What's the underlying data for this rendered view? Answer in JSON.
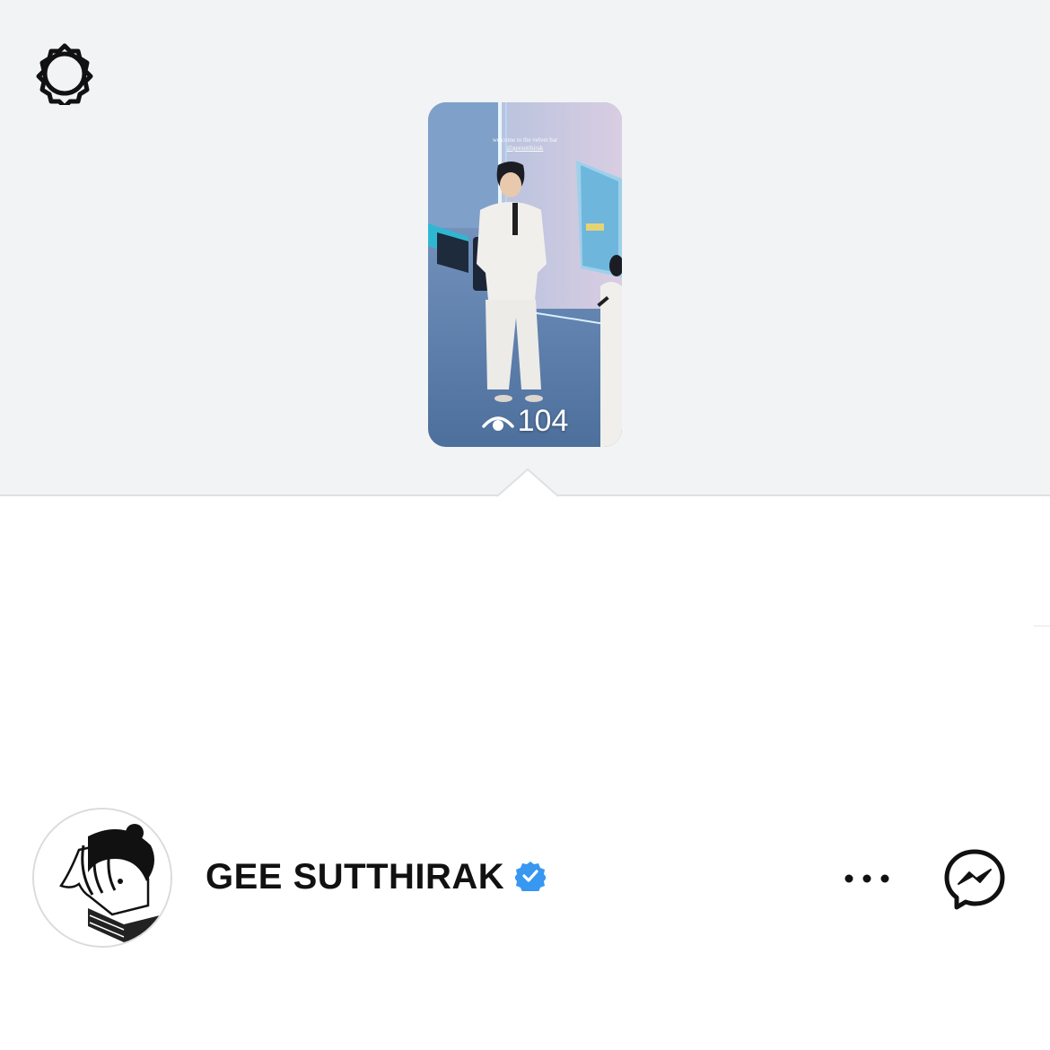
{
  "header": {
    "settings_icon": "gear-icon"
  },
  "story_preview": {
    "caption_line1": "welcome to the velvet bar",
    "caption_line2": "@geesutthirak",
    "view_icon": "eye-icon",
    "view_count": "104"
  },
  "profile": {
    "username": "GEE SUTTHIRAK",
    "verified": true,
    "verified_color": "#3897f0",
    "avatar_icon": "avatar-illustration",
    "more_icon": "more-horizontal-icon",
    "message_icon": "messenger-icon"
  }
}
